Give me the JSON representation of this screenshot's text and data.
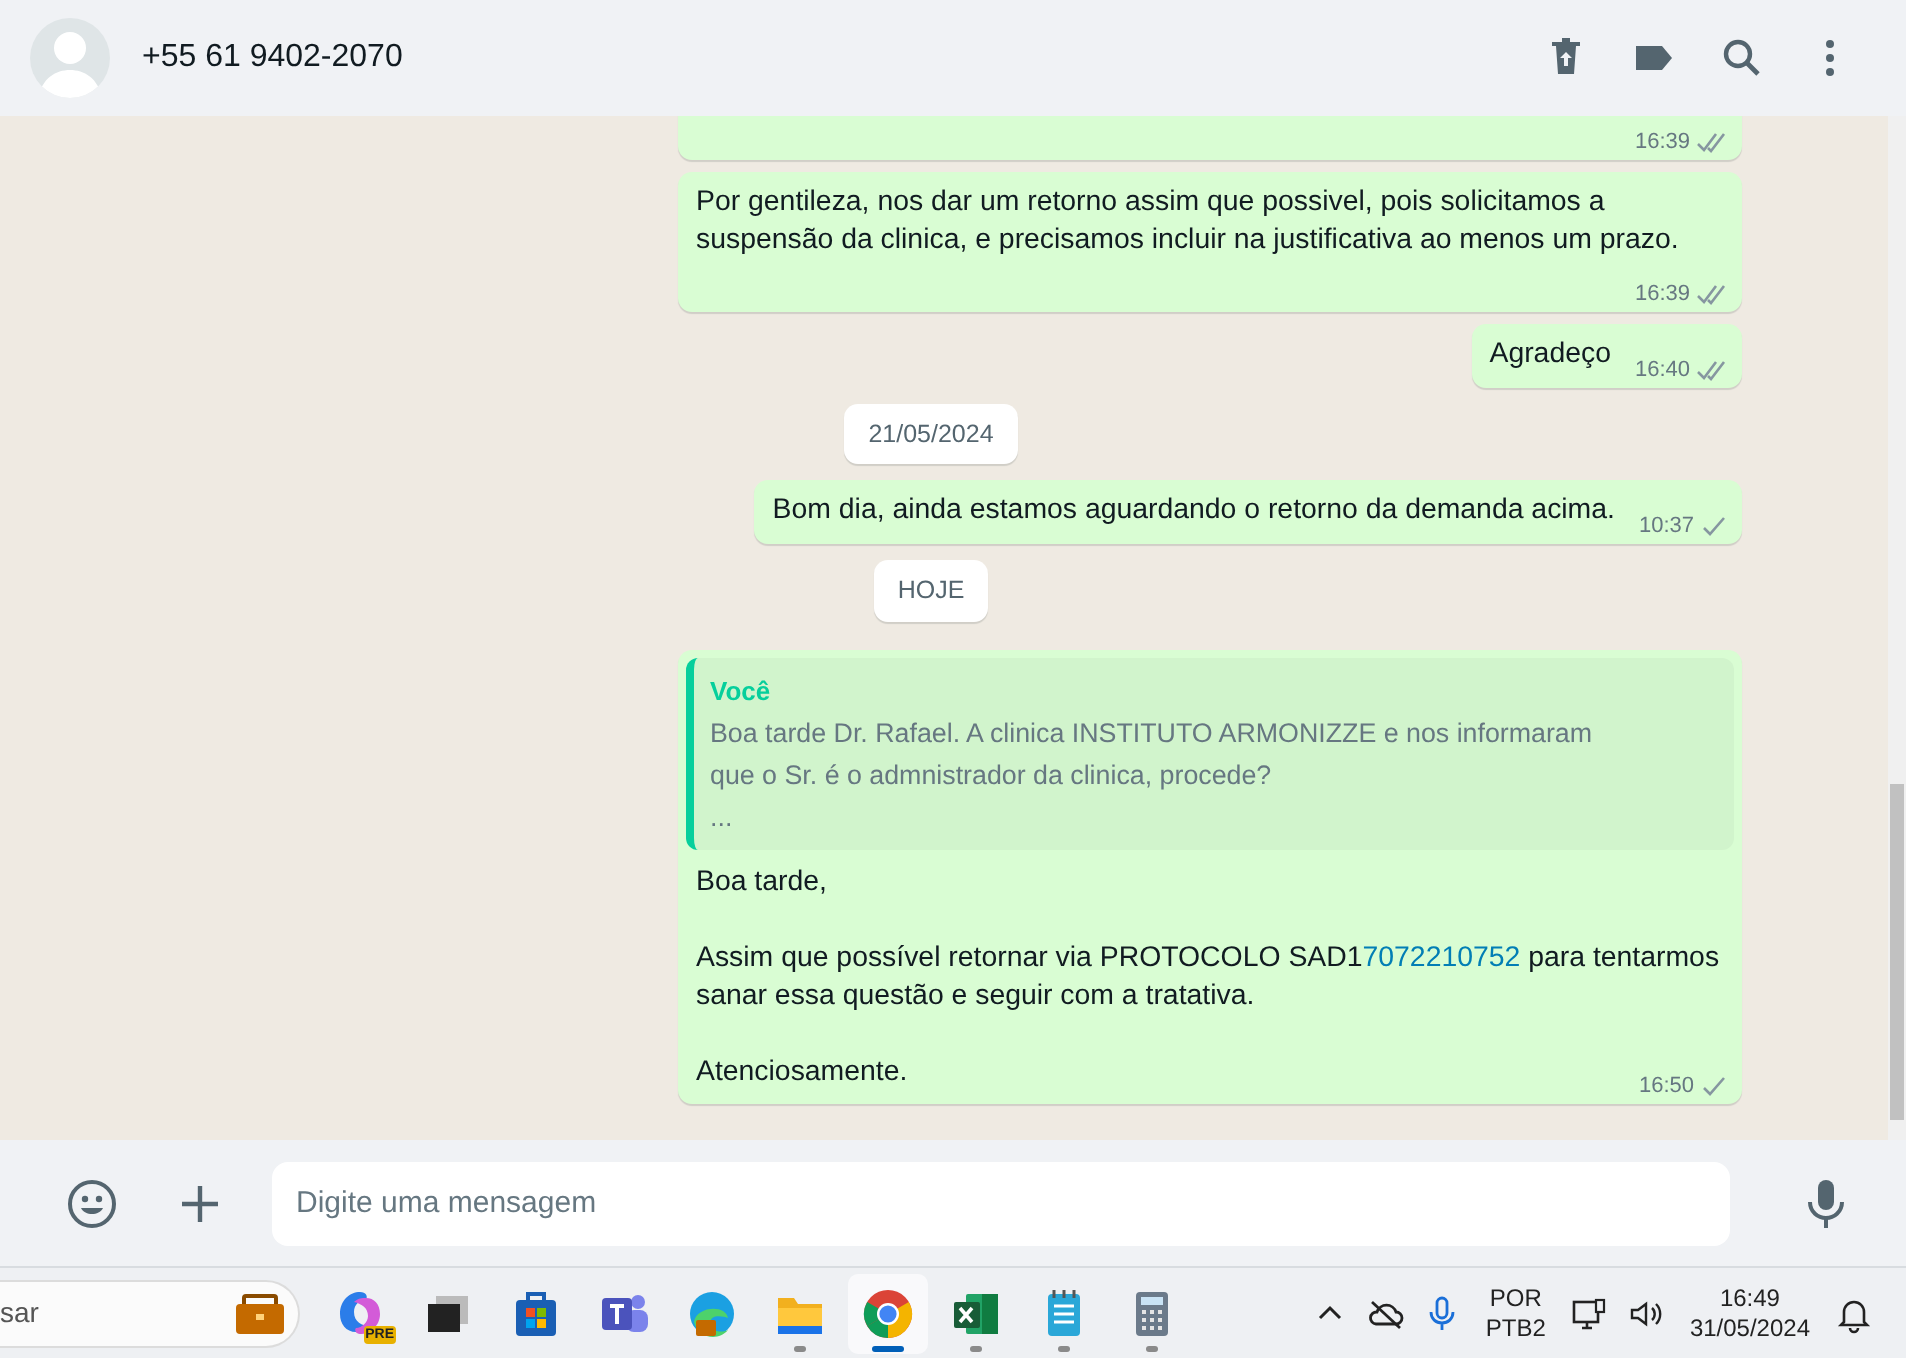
{
  "header": {
    "contact": "+55 61 9402-2070"
  },
  "messages": [
    {
      "kind": "cut",
      "time": "16:39",
      "delivered": true
    },
    {
      "kind": "text",
      "text": "Por gentileza, nos dar um retorno assim que possivel, pois solicitamos a suspensão da clinica, e precisamos incluir na justificativa ao menos um prazo.",
      "time": "16:39",
      "delivered": true
    },
    {
      "kind": "text",
      "text": "Agradeço",
      "time": "16:40",
      "delivered": true
    },
    {
      "kind": "date",
      "text": "21/05/2024"
    },
    {
      "kind": "text",
      "text": "Bom dia, ainda estamos aguardando o retorno da demanda acima.",
      "time": "10:37",
      "delivered": false
    },
    {
      "kind": "date",
      "text": "HOJE"
    },
    {
      "kind": "reply",
      "quote": {
        "author": "Você",
        "lines": [
          "Boa tarde Dr. Rafael. A clinica INSTITUTO ARMONIZZE e nos informaram",
          "que o Sr. é o admnistrador da clinica, procede?",
          "..."
        ]
      },
      "paragraphs": [
        [
          {
            "kind": "text",
            "text": "Boa tarde,"
          }
        ],
        [
          {
            "kind": "text",
            "text": "Assim que possível retornar via PROTOCOLO SAD1"
          },
          {
            "kind": "link",
            "text": "7072210752"
          },
          {
            "kind": "text",
            "text": " para tentarmos sanar essa questão e seguir com a tratativa."
          }
        ],
        [
          {
            "kind": "text",
            "text": "Atenciosamente."
          }
        ]
      ],
      "time": "16:50",
      "delivered": false
    }
  ],
  "composer": {
    "placeholder": "Digite uma mensagem"
  },
  "taskbar": {
    "search": "sar",
    "apps": [
      {
        "badge": "PRE",
        "running": false,
        "selected": false
      },
      {
        "running": false,
        "selected": false
      },
      {
        "running": false,
        "selected": false
      },
      {
        "running": false,
        "selected": false
      },
      {
        "running": false,
        "selected": false
      },
      {
        "running": true,
        "selected": false
      },
      {
        "running": true,
        "selected": true
      },
      {
        "running": true,
        "selected": false
      },
      {
        "running": true,
        "selected": false
      },
      {
        "running": true,
        "selected": false
      }
    ],
    "language": [
      "POR",
      "PTB2"
    ],
    "time": "16:49",
    "date": "31/05/2024"
  }
}
